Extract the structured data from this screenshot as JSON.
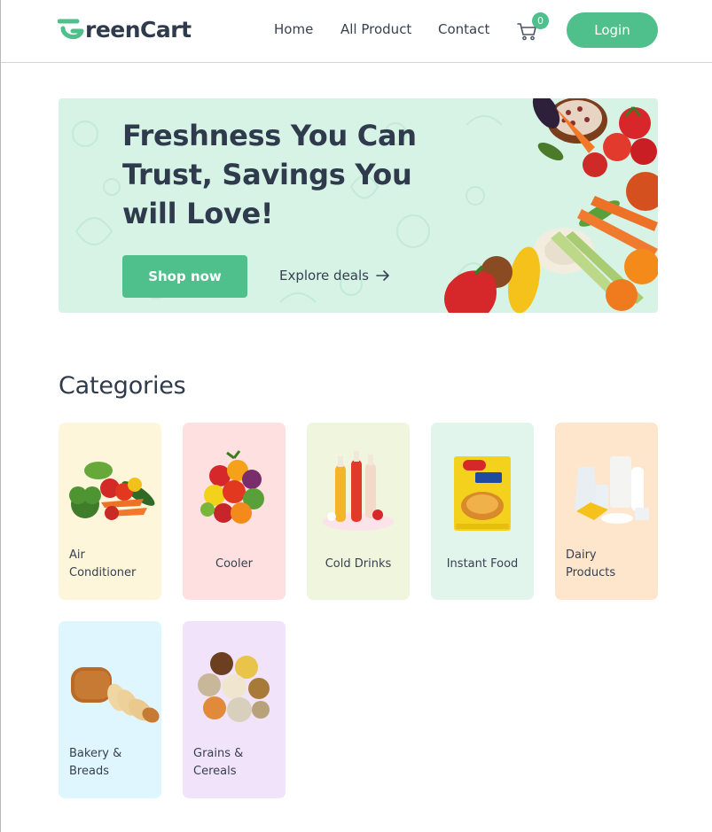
{
  "brand": {
    "logo_text": "reenCart",
    "logo_full": "GreenCart",
    "accent_color": "#4fbf8b"
  },
  "nav": {
    "links": [
      "Home",
      "All Product",
      "Contact"
    ],
    "cart_count": "0",
    "cart_icon": "shopping-cart-icon",
    "login_label": "Login"
  },
  "hero": {
    "title_lines": [
      "Freshness You Can",
      "Trust, Savings You",
      "will Love!"
    ],
    "shop_label": "Shop now",
    "explore_label": "Explore deals",
    "explore_icon": "arrow-right-icon"
  },
  "categories": {
    "heading": "Categories",
    "items": [
      {
        "label": "Air Conditioner",
        "lines": [
          "Air",
          "Conditioner"
        ],
        "bg": "#fef6da",
        "icon": "vegetables-image"
      },
      {
        "label": "Cooler",
        "lines": [
          "Cooler"
        ],
        "bg": "#fee0e0",
        "icon": "fruits-image"
      },
      {
        "label": "Cold Drinks",
        "lines": [
          "Cold Drinks"
        ],
        "bg": "#f0f5de",
        "icon": "cold-drinks-image"
      },
      {
        "label": "Instant Food",
        "lines": [
          "Instant Food"
        ],
        "bg": "#e1f5ec",
        "icon": "instant-noodles-image"
      },
      {
        "label": "Dairy Products",
        "lines": [
          "Dairy",
          "Products"
        ],
        "bg": "#fee6cd",
        "icon": "dairy-image"
      },
      {
        "label": "Bakery & Breads",
        "lines": [
          "Bakery &",
          "Breads"
        ],
        "bg": "#e0f6fe",
        "icon": "bread-image"
      },
      {
        "label": "Grains & Cereals",
        "lines": [
          "Grains &",
          "Cereals"
        ],
        "bg": "#f1e3f9",
        "icon": "grains-image"
      }
    ]
  }
}
